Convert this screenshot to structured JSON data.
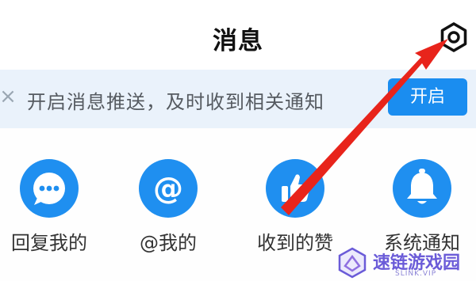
{
  "header": {
    "title": "消息",
    "settings_icon": "settings-hexagon-icon"
  },
  "banner": {
    "close_icon": "close-icon",
    "text": "开启消息推送，及时收到相关通知",
    "button_label": "开启"
  },
  "grid": {
    "items": [
      {
        "label": "回复我的",
        "icon": "chat-bubble-dots-icon"
      },
      {
        "label": "@我的",
        "icon": "at-sign-icon"
      },
      {
        "label": "收到的赞",
        "icon": "thumbs-up-icon"
      },
      {
        "label": "系统通知",
        "icon": "bell-icon"
      }
    ]
  },
  "watermark": {
    "name": "速链游戏园",
    "domain": "SLINK.VIP"
  },
  "colors": {
    "accent": "#1f8ff0",
    "banner_bg": "#eaf2fb",
    "annotation_arrow": "#e8241b"
  }
}
